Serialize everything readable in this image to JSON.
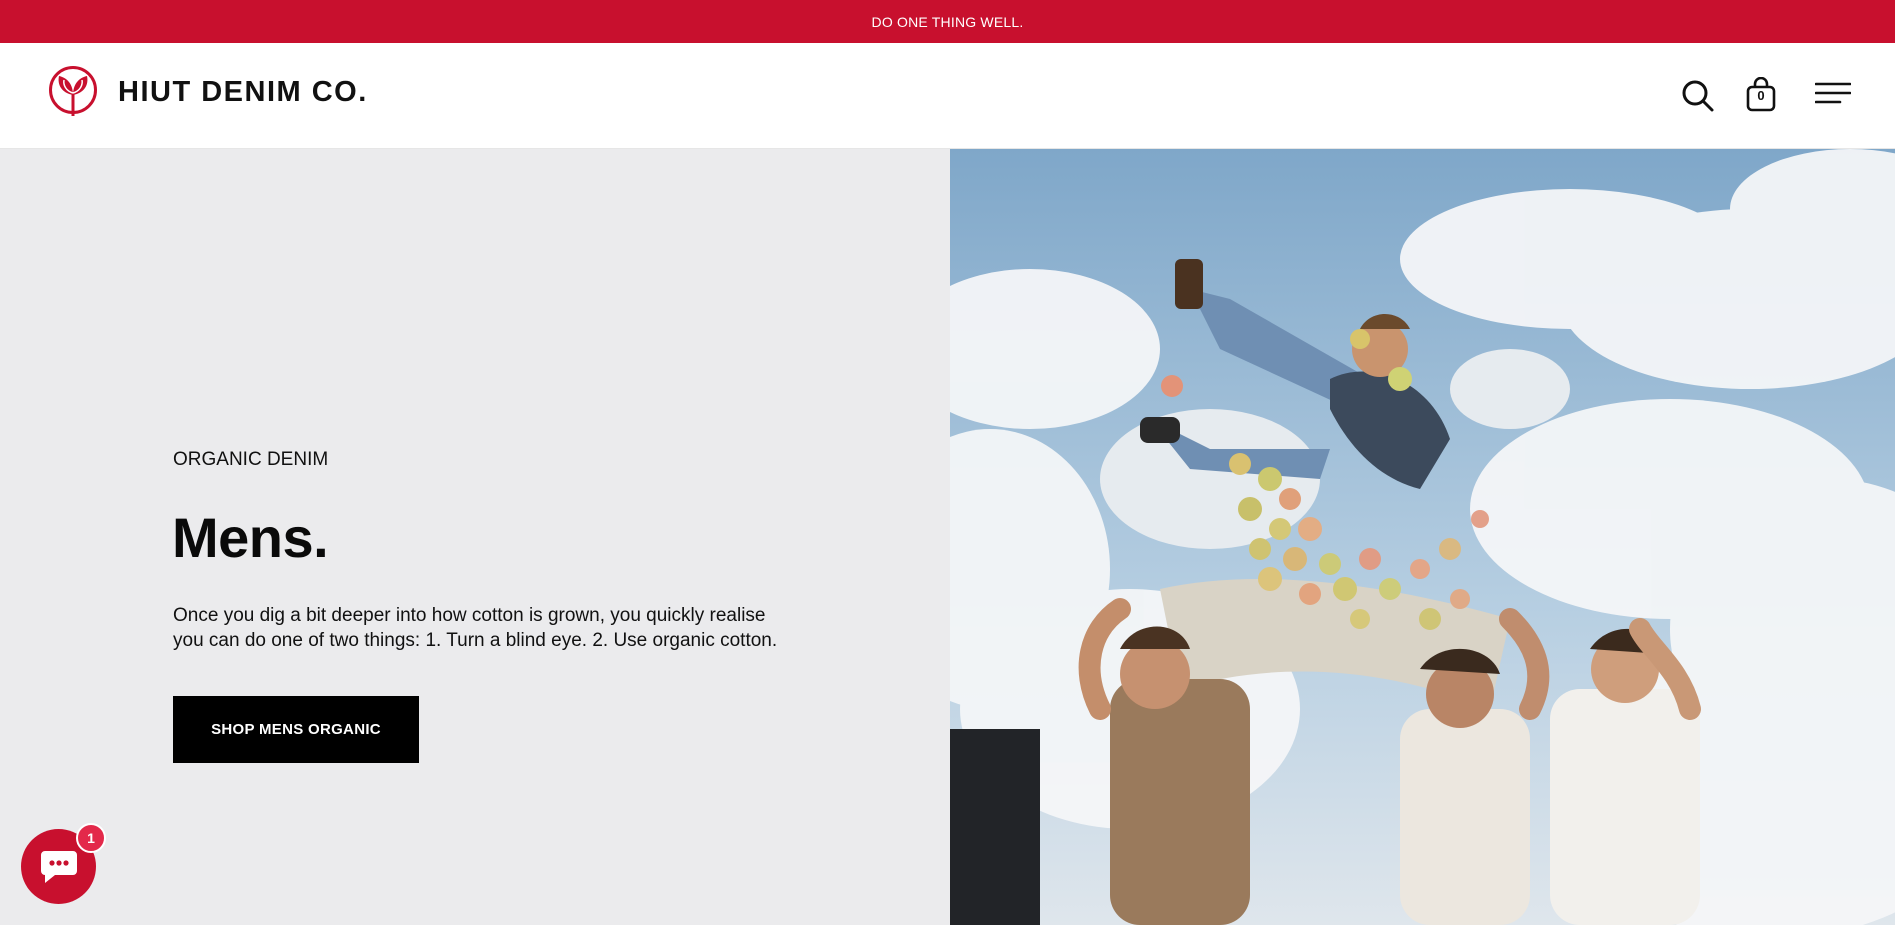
{
  "announcement": {
    "text": "DO ONE THING WELL."
  },
  "header": {
    "brand_name": "HIUT DENIM CO.",
    "logo_icon": "leaf-circle-logo-icon",
    "search_icon": "search-icon",
    "cart_icon": "shopping-bag-icon",
    "cart_count": "0",
    "menu_icon": "hamburger-menu-icon"
  },
  "hero": {
    "eyebrow": "ORGANIC DENIM",
    "headline": "Mens.",
    "body": "Once you dig a bit deeper into how cotton is grown, you quickly realise you can do one of two things: 1. Turn a blind eye. 2. Use organic cotton.",
    "cta_label": "SHOP MENS ORGANIC"
  },
  "chat": {
    "icon": "chat-bubble-icon",
    "badge_count": "1"
  },
  "colors": {
    "brand_red": "#c8102e",
    "hero_left_bg": "#ebebed",
    "cta_bg": "#000000"
  }
}
